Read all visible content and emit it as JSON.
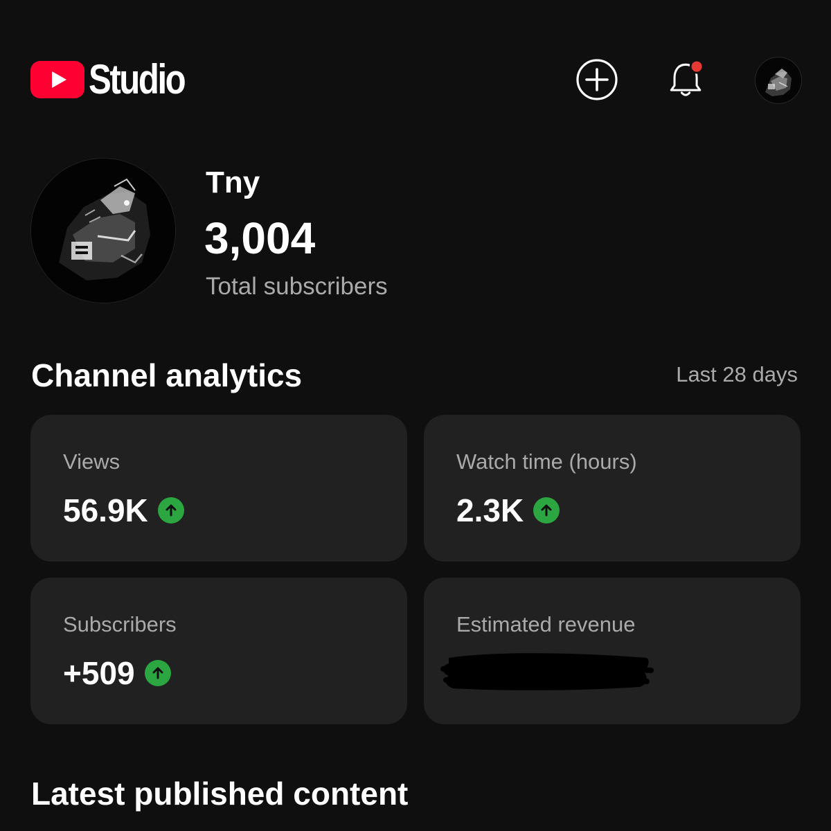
{
  "header": {
    "logo_text": "Studio",
    "brand_color": "#ff0033",
    "icons": [
      "youtube-play-icon",
      "create-plus-icon",
      "notification-bell-icon",
      "account-avatar"
    ],
    "notification_badge_color": "#e53935"
  },
  "channel": {
    "name": "Tny",
    "subscriber_count": "3,004",
    "subscriber_caption": "Total subscribers"
  },
  "analytics": {
    "title": "Channel analytics",
    "period": "Last 28 days",
    "trend_color": "#2ba640",
    "cards": [
      {
        "label": "Views",
        "value": "56.9K",
        "trend": "up"
      },
      {
        "label": "Watch time (hours)",
        "value": "2.3K",
        "trend": "up"
      },
      {
        "label": "Subscribers",
        "value": "+509",
        "trend": "up"
      },
      {
        "label": "Estimated revenue",
        "value": "",
        "redacted": true
      }
    ]
  },
  "latest": {
    "title": "Latest published content"
  }
}
